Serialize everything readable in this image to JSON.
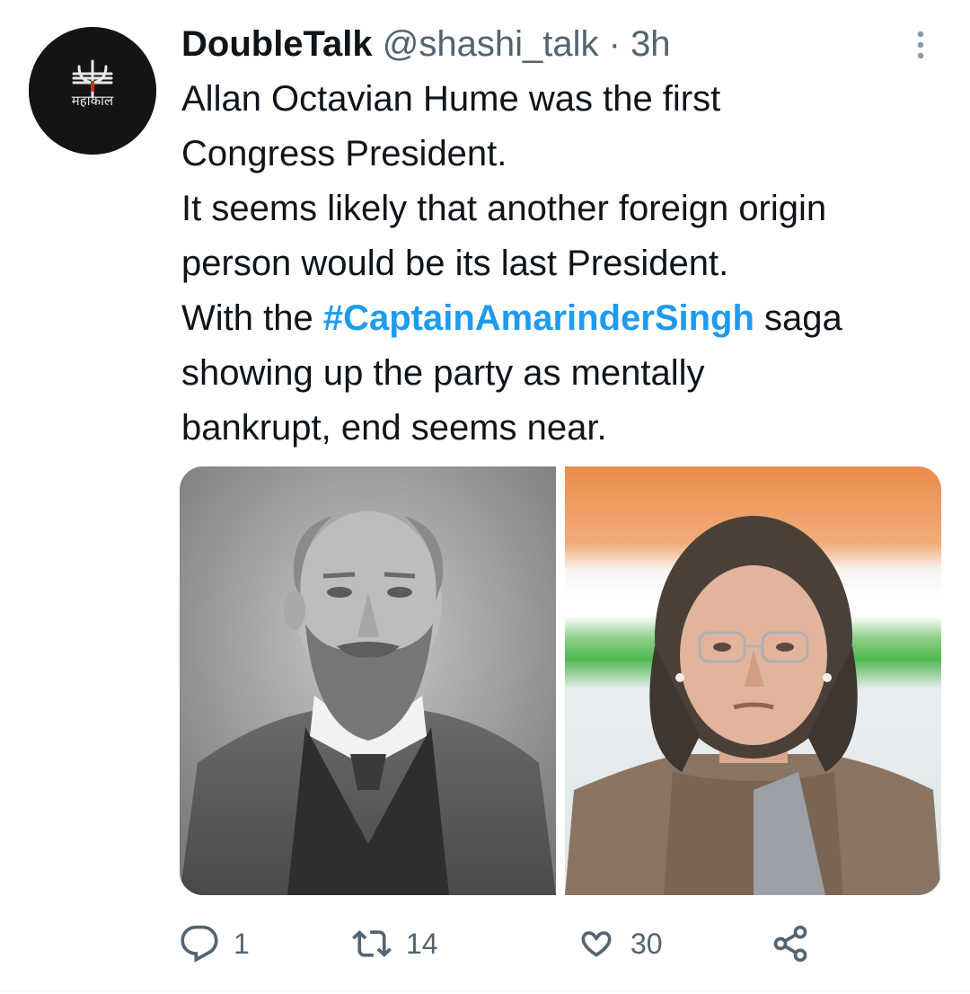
{
  "tweet": {
    "author": {
      "display_name": "DoubleTalk",
      "handle": "@shashi_talk",
      "separator": "·",
      "time": "3h",
      "avatar_icon": "mahakal-avatar-icon"
    },
    "text": {
      "line1": "Allan Octavian Hume was the first",
      "line2": "Congress President.",
      "line3": "It seems likely that another foreign origin",
      "line4": "person would be its last President.",
      "line5_before": "With the ",
      "hashtag": "#CaptainAmarinderSingh",
      "line5_after": " saga",
      "line6": "showing up the party as mentally",
      "line7": "bankrupt, end seems near."
    },
    "media": [
      {
        "icon": "portrait-photo-bw"
      },
      {
        "icon": "portrait-photo-color"
      }
    ],
    "actions": {
      "reply_count": "1",
      "retweet_count": "14",
      "like_count": "30"
    },
    "colors": {
      "text": "#0f1419",
      "secondary": "#536471",
      "link": "#1d9bf0"
    }
  }
}
